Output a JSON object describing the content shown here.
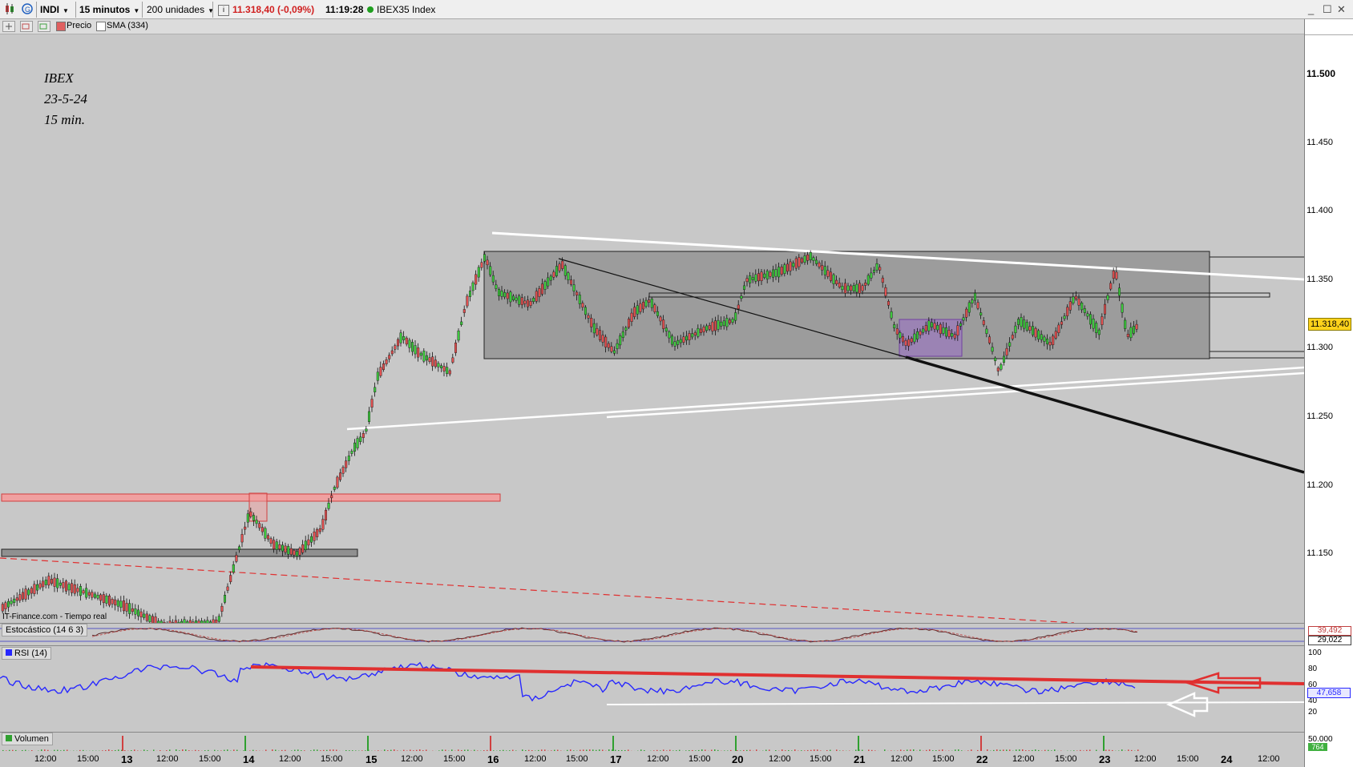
{
  "toolbar": {
    "symbol": "INDI",
    "interval": "15 minutos",
    "units": "200 unidades",
    "price_change": "11.318,40 (-0,09%)",
    "time": "11:19:28",
    "index_name": "IBEX35 Index"
  },
  "subbar": {
    "precio_label": "Precio",
    "sma_label": "SMA (334)"
  },
  "annotation": {
    "line1": "IBEX",
    "line2": "23-5-24",
    "line3": "15 min."
  },
  "watermark": "IT-Finance.com - Tiempo real",
  "price_axis": {
    "labels": [
      "11.500",
      "11.450",
      "11.400",
      "11.350",
      "11.300",
      "11.250",
      "11.200",
      "11.150"
    ],
    "current_price": "11.318,40"
  },
  "stochastic": {
    "label": "Estocástico (14 6 3)",
    "value1": "39,492",
    "value2": "29,022"
  },
  "rsi": {
    "label": "RSI (14)",
    "value": "47,658",
    "axis": [
      "100",
      "80",
      "60",
      "40",
      "20"
    ]
  },
  "volume": {
    "label": "Volumen",
    "axis_top": "50.000",
    "value": "764"
  },
  "time_axis": {
    "labels": [
      "12:00",
      "15:00",
      "13",
      "12:00",
      "15:00",
      "14",
      "12:00",
      "15:00",
      "15",
      "12:00",
      "15:00",
      "16",
      "12:00",
      "15:00",
      "17",
      "12:00",
      "15:00",
      "20",
      "12:00",
      "15:00",
      "21",
      "12:00",
      "15:00",
      "22",
      "12:00",
      "15:00",
      "23",
      "12:00",
      "15:00",
      "24",
      "12:00"
    ]
  },
  "colors": {
    "background": "#c8c8c8",
    "bull_candle": "#3cc83c",
    "bear_candle": "#e05050",
    "rsi_line": "#2828ff",
    "red_line": "#e03030",
    "current_price_box": "#ffd21c"
  }
}
